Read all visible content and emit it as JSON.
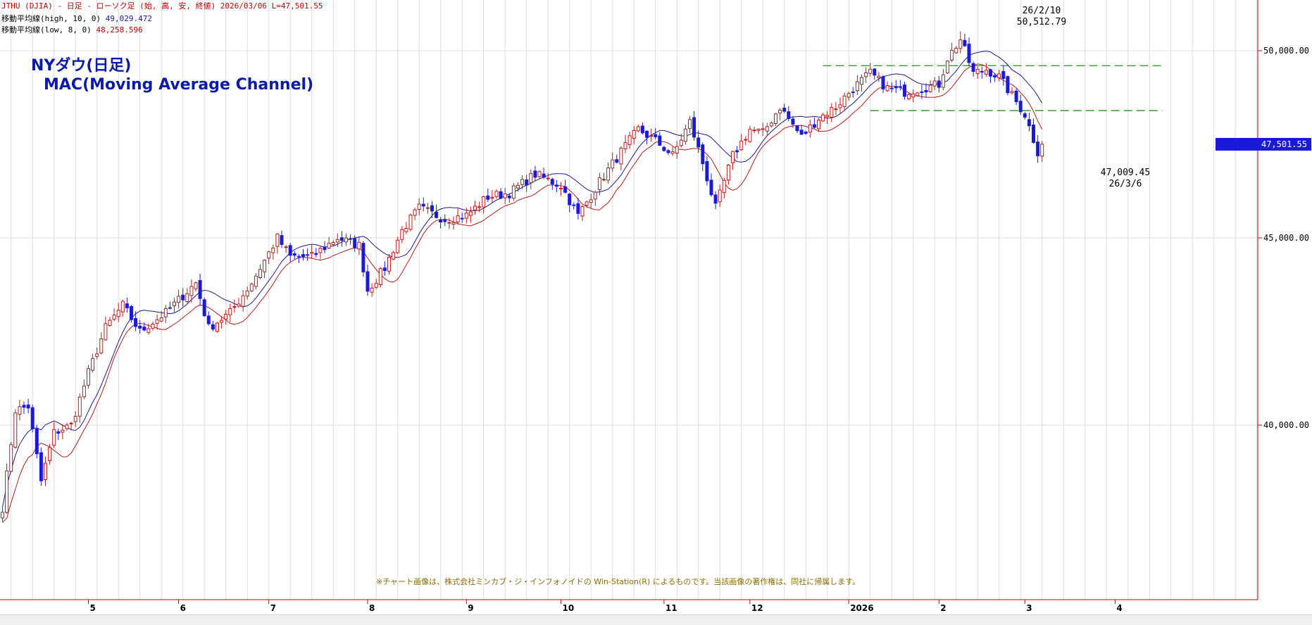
{
  "header": {
    "main": "JTHU (DJIA) - 日足 - ローソク足 (始, 高, 安, 終値)  2026/03/06 L=47,501.55",
    "ma1_label": "移動平均線(high, 10, 0)",
    "ma1_value": "49,029.472",
    "ma2_label": "移動平均線(low, 8, 0)",
    "ma2_value": "48,258.596"
  },
  "title_line1": "NYダウ(日足)",
  "title_line2": "MAC(Moving Average Channel)",
  "footer_note": "※チャート画像は、株式会社ミンカブ・ジ・インフォノイドの Win-Station(R) によるものです。当該画像の著作権は、同社に帰属します。",
  "annotation_high": {
    "date": "26/2/10",
    "value": "50,512.79"
  },
  "annotation_low": {
    "value": "47,009.45",
    "date": "26/3/6"
  },
  "last_price_label": "47,501.55",
  "colors": {
    "up": "#b81a1a",
    "down": "#1b1bd6",
    "ma_high": "#1a1a8a",
    "ma_low": "#b31a1a",
    "support": "#3a9a3a",
    "title": "#0b1aa8"
  },
  "chart_data": {
    "type": "candlestick",
    "ylim": [
      36500,
      51300
    ],
    "y_ticks": [
      {
        "value": 40000,
        "label": "40,000.00"
      },
      {
        "value": 45000,
        "label": "45,000.00"
      },
      {
        "value": 50000,
        "label": "50,000.00"
      }
    ],
    "x_labels": [
      {
        "label": "5",
        "index": 20
      },
      {
        "label": "6",
        "index": 41
      },
      {
        "label": "7",
        "index": 62
      },
      {
        "label": "8",
        "index": 85
      },
      {
        "label": "9",
        "index": 108
      },
      {
        "label": "10",
        "index": 130
      },
      {
        "label": "11",
        "index": 154
      },
      {
        "label": "12",
        "index": 174
      },
      {
        "label": "2026",
        "index": 197
      },
      {
        "label": "2",
        "index": 218
      },
      {
        "label": "3",
        "index": 238
      },
      {
        "label": "4",
        "index": 259
      }
    ],
    "candles_count": 243,
    "anchors": [
      [
        0,
        37800
      ],
      [
        3,
        40400
      ],
      [
        6,
        40500
      ],
      [
        9,
        38500
      ],
      [
        12,
        39800
      ],
      [
        16,
        40000
      ],
      [
        20,
        41400
      ],
      [
        24,
        42600
      ],
      [
        28,
        43200
      ],
      [
        32,
        42500
      ],
      [
        38,
        43000
      ],
      [
        45,
        43800
      ],
      [
        48,
        42600
      ],
      [
        53,
        43000
      ],
      [
        58,
        43800
      ],
      [
        62,
        44600
      ],
      [
        64,
        45000
      ],
      [
        67,
        44500
      ],
      [
        72,
        44500
      ],
      [
        78,
        45000
      ],
      [
        83,
        44800
      ],
      [
        85,
        43600
      ],
      [
        89,
        44200
      ],
      [
        93,
        45200
      ],
      [
        97,
        45800
      ],
      [
        103,
        45500
      ],
      [
        108,
        45600
      ],
      [
        113,
        46100
      ],
      [
        118,
        46200
      ],
      [
        124,
        46700
      ],
      [
        130,
        46400
      ],
      [
        134,
        45600
      ],
      [
        139,
        46500
      ],
      [
        144,
        47300
      ],
      [
        148,
        47900
      ],
      [
        152,
        47600
      ],
      [
        156,
        47200
      ],
      [
        160,
        48100
      ],
      [
        163,
        47000
      ],
      [
        166,
        45800
      ],
      [
        170,
        47200
      ],
      [
        174,
        47900
      ],
      [
        177,
        47800
      ],
      [
        181,
        48500
      ],
      [
        186,
        47700
      ],
      [
        190,
        48200
      ],
      [
        194,
        48500
      ],
      [
        198,
        49000
      ],
      [
        202,
        49400
      ],
      [
        206,
        49000
      ],
      [
        210,
        48900
      ],
      [
        214,
        49000
      ],
      [
        218,
        49100
      ],
      [
        220,
        49800
      ],
      [
        223,
        50300
      ],
      [
        226,
        49400
      ],
      [
        229,
        49500
      ],
      [
        232,
        49300
      ],
      [
        235,
        48800
      ],
      [
        238,
        48300
      ],
      [
        241,
        47300
      ],
      [
        242,
        47500
      ]
    ],
    "support_lines": [
      {
        "value": 49600,
        "from_index": 191,
        "to_index": 270
      },
      {
        "value": 48400,
        "from_index": 202,
        "to_index": 270
      }
    ],
    "annotation_high_index": 223,
    "annotation_low_index": 241,
    "annotation_high_value": 50512.79,
    "annotation_low_value": 47009.45
  }
}
